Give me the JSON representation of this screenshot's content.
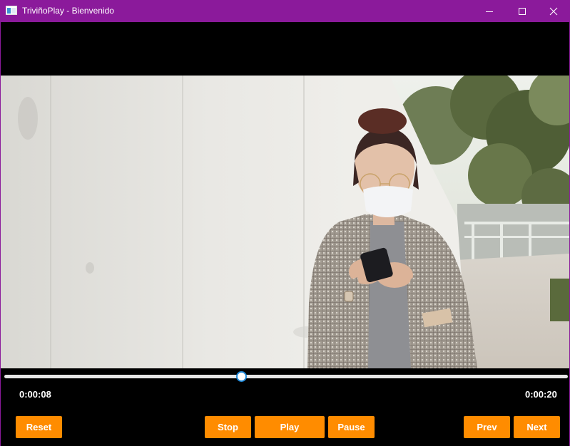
{
  "window": {
    "title": "TriviñoPlay - Bienvenido",
    "accent_color": "#8b1a9b",
    "icon": "app-window-icon",
    "controls": [
      "minimize-icon",
      "maximize-icon",
      "close-icon"
    ]
  },
  "player": {
    "current_time": "0:00:08",
    "total_time": "0:00:20",
    "progress": 0.42,
    "slider_thumb_color": "#1e88d8",
    "video_content": "woman in a mask and glasses looking at her phone by a white concrete wall"
  },
  "controls": {
    "button_color": "#ff8c00",
    "reset": "Reset",
    "stop": "Stop",
    "play": "Play",
    "pause": "Pause",
    "prev": "Prev",
    "next": "Next"
  }
}
